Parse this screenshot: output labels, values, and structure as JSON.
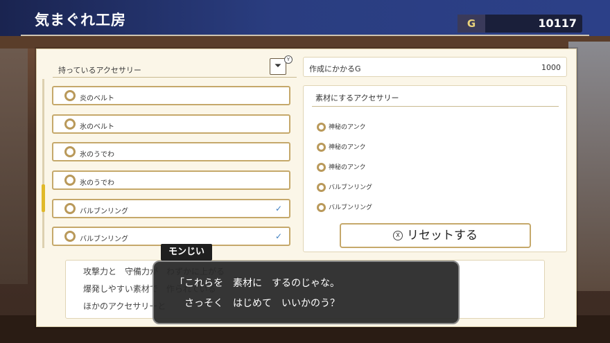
{
  "header": {
    "title": "気まぐれ工房",
    "gold_label": "G",
    "gold_value": "10117"
  },
  "left_list": {
    "header": "持っているアクセサリー",
    "filter_icon": "filter-icon",
    "items": [
      {
        "label": "炎のベルト",
        "checked": false
      },
      {
        "label": "氷のベルト",
        "checked": false
      },
      {
        "label": "氷のうでわ",
        "checked": false
      },
      {
        "label": "氷のうでわ",
        "checked": false
      },
      {
        "label": "バルブンリング",
        "checked": true
      },
      {
        "label": "バルブンリング",
        "checked": true
      }
    ],
    "check_glyph": "✓"
  },
  "cost": {
    "label": "作成にかかるG",
    "value": "1000"
  },
  "materials": {
    "title": "素材にするアクセサリー",
    "items": [
      "神秘のアンク",
      "神秘のアンク",
      "神秘のアンク",
      "バルブンリング",
      "バルブンリング"
    ]
  },
  "reset": {
    "label": "リセットする"
  },
  "description": {
    "lines": [
      "攻撃力と　守備力が　わずかに上がる",
      "爆発しやすい素材で　作られている",
      "ほかのアクセサリーと"
    ]
  },
  "dialog": {
    "speaker": "モンじい",
    "lines": [
      "「これらを　素材に　するのじゃな。",
      "さっそく　はじめて　いいかのう？"
    ]
  },
  "colors": {
    "accent": "#c5a86a",
    "check": "#3e7fc0",
    "topbar": "#2a3d80"
  }
}
